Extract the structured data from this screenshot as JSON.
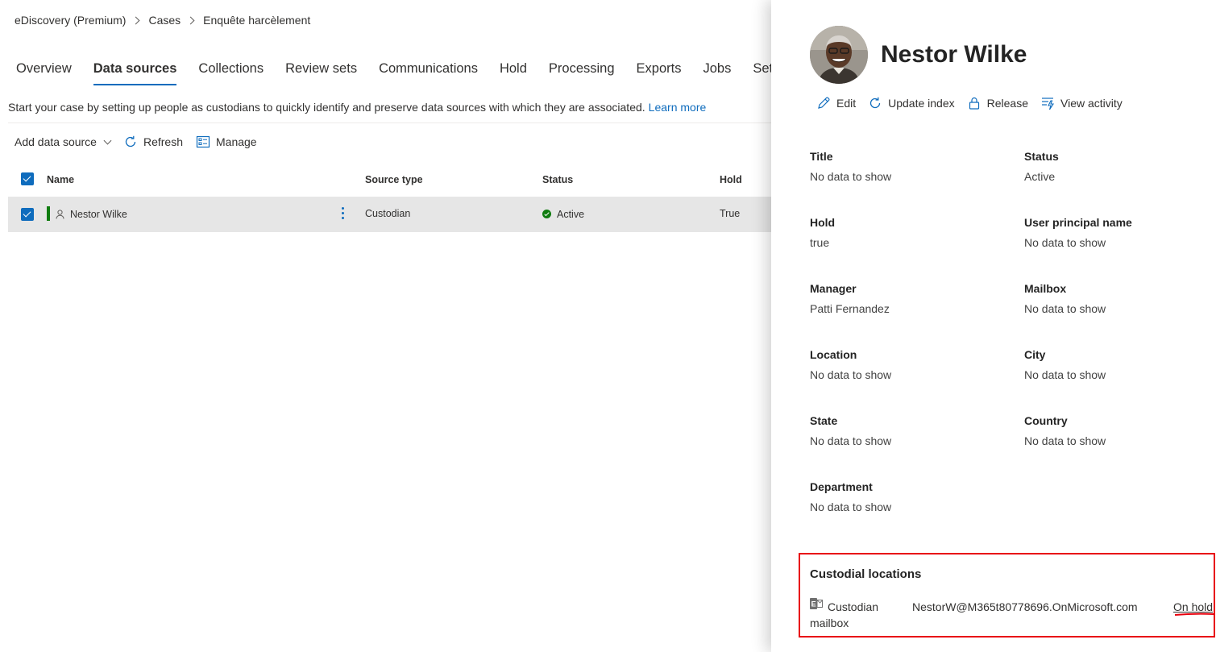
{
  "breadcrumb": [
    "eDiscovery (Premium)",
    "Cases",
    "Enquête harcèlement"
  ],
  "tabs": [
    {
      "label": "Overview"
    },
    {
      "label": "Data sources",
      "active": true
    },
    {
      "label": "Collections"
    },
    {
      "label": "Review sets"
    },
    {
      "label": "Communications"
    },
    {
      "label": "Hold"
    },
    {
      "label": "Processing"
    },
    {
      "label": "Exports"
    },
    {
      "label": "Jobs"
    },
    {
      "label": "Settings"
    }
  ],
  "intro": {
    "text": "Start your case by setting up people as custodians to quickly identify and preserve data sources with which they are associated.",
    "link": "Learn more"
  },
  "toolbar": {
    "add_label": "Add data source",
    "refresh_label": "Refresh",
    "manage_label": "Manage"
  },
  "table": {
    "columns": [
      "Name",
      "Source type",
      "Status",
      "Hold"
    ],
    "rows": [
      {
        "name": "Nestor Wilke",
        "source_type": "Custodian",
        "status": "Active",
        "hold": "True",
        "selected": true
      }
    ]
  },
  "panel": {
    "name": "Nestor Wilke",
    "actions": {
      "edit": "Edit",
      "update_index": "Update index",
      "release": "Release",
      "view_activity": "View activity"
    },
    "fields": {
      "title": {
        "label": "Title",
        "value": "No data to show"
      },
      "status": {
        "label": "Status",
        "value": "Active"
      },
      "hold": {
        "label": "Hold",
        "value": "true"
      },
      "upn": {
        "label": "User principal name",
        "value": "No data to show"
      },
      "manager": {
        "label": "Manager",
        "value": "Patti Fernandez"
      },
      "mailbox": {
        "label": "Mailbox",
        "value": "No data to show"
      },
      "location": {
        "label": "Location",
        "value": "No data to show"
      },
      "city": {
        "label": "City",
        "value": "No data to show"
      },
      "state": {
        "label": "State",
        "value": "No data to show"
      },
      "country": {
        "label": "Country",
        "value": "No data to show"
      },
      "department": {
        "label": "Department",
        "value": "No data to show"
      }
    },
    "custodial_locations": {
      "title": "Custodial locations",
      "items": [
        {
          "type": "Custodian mailbox",
          "address": "NestorW@M365t80778696.OnMicrosoft.com",
          "status": "On hold"
        }
      ]
    }
  },
  "colors": {
    "accent": "#0f6cbd",
    "active_green": "#107c10",
    "highlight_red": "#e8000d"
  },
  "icons": [
    "chevron-right-icon",
    "chevron-down-icon",
    "refresh-icon",
    "manage-icon",
    "person-icon",
    "more-icon",
    "check-circle-icon",
    "edit-icon",
    "lock-icon",
    "activity-icon",
    "exchange-icon"
  ]
}
